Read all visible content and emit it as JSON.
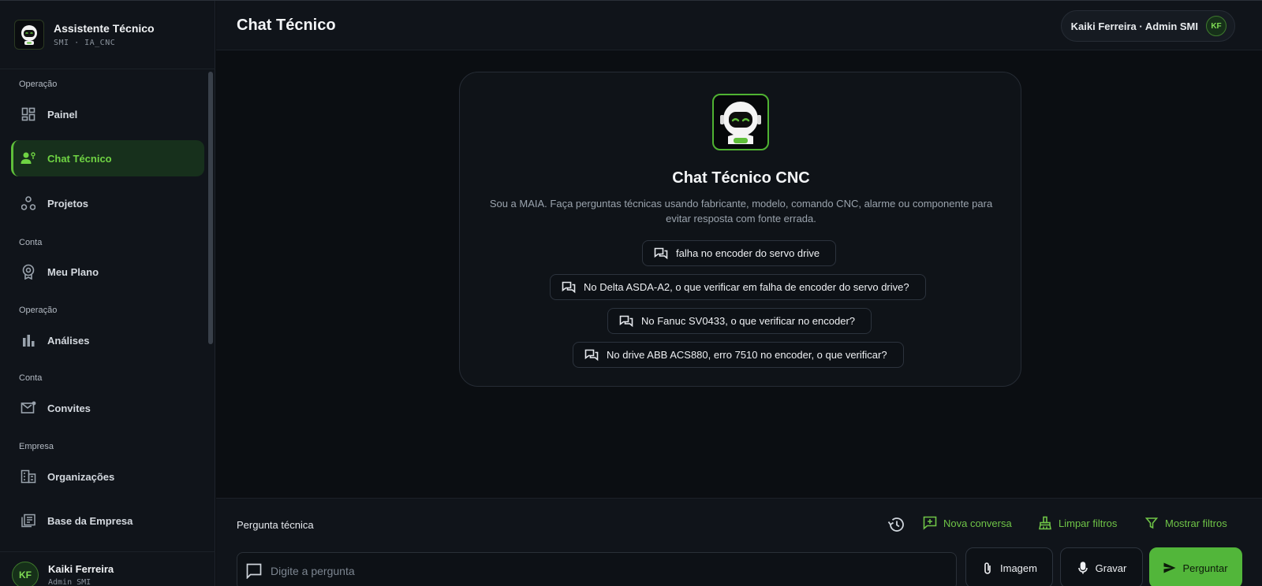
{
  "app": {
    "title": "Assistente Técnico",
    "subtitle": "SMI · IA_CNC"
  },
  "sidebar": {
    "sections": [
      {
        "label": "Operação"
      },
      {
        "label": "Conta"
      },
      {
        "label": "Operação"
      },
      {
        "label": "Conta"
      },
      {
        "label": "Empresa"
      }
    ],
    "items": [
      {
        "label": "Painel",
        "icon": "dashboard-icon",
        "active": false
      },
      {
        "label": "Chat Técnico",
        "icon": "support-agent-icon",
        "active": true
      },
      {
        "label": "Projetos",
        "icon": "hub-icon",
        "active": false
      },
      {
        "label": "Meu Plano",
        "icon": "badge-icon",
        "active": false
      },
      {
        "label": "Análises",
        "icon": "bar-chart-icon",
        "active": false
      },
      {
        "label": "Convites",
        "icon": "mail-icon",
        "active": false
      },
      {
        "label": "Organizações",
        "icon": "building-icon",
        "active": false
      },
      {
        "label": "Base da Empresa",
        "icon": "library-icon",
        "active": false
      }
    ],
    "user": {
      "initials": "KF",
      "name": "Kaiki Ferreira",
      "role": "Admin SMI"
    }
  },
  "header": {
    "title": "Chat Técnico",
    "user_pill": "Kaiki Ferreira · Admin SMI",
    "user_initials": "KF"
  },
  "welcome": {
    "title": "Chat Técnico CNC",
    "description": "Sou a MAIA. Faça perguntas técnicas usando fabricante, modelo, comando CNC, alarme ou componente para evitar resposta com fonte errada.",
    "suggestions": [
      "falha no encoder do servo drive",
      "No Delta ASDA-A2, o que verificar em falha de encoder do servo drive?",
      "No Fanuc SV0433, o que verificar no encoder?",
      "No drive ABB ACS880, erro 7510 no encoder, o que verificar?"
    ]
  },
  "composer": {
    "label": "Pergunta técnica",
    "new_chat": "Nova conversa",
    "clear_filters": "Limpar filtros",
    "show_filters": "Mostrar filtros",
    "placeholder": "Digite a pergunta",
    "image_button": "Imagem",
    "record_button": "Gravar",
    "send_button": "Perguntar"
  },
  "colors": {
    "accent": "#52b63a",
    "background": "#0b0e12",
    "sidebar": "#10141a"
  }
}
